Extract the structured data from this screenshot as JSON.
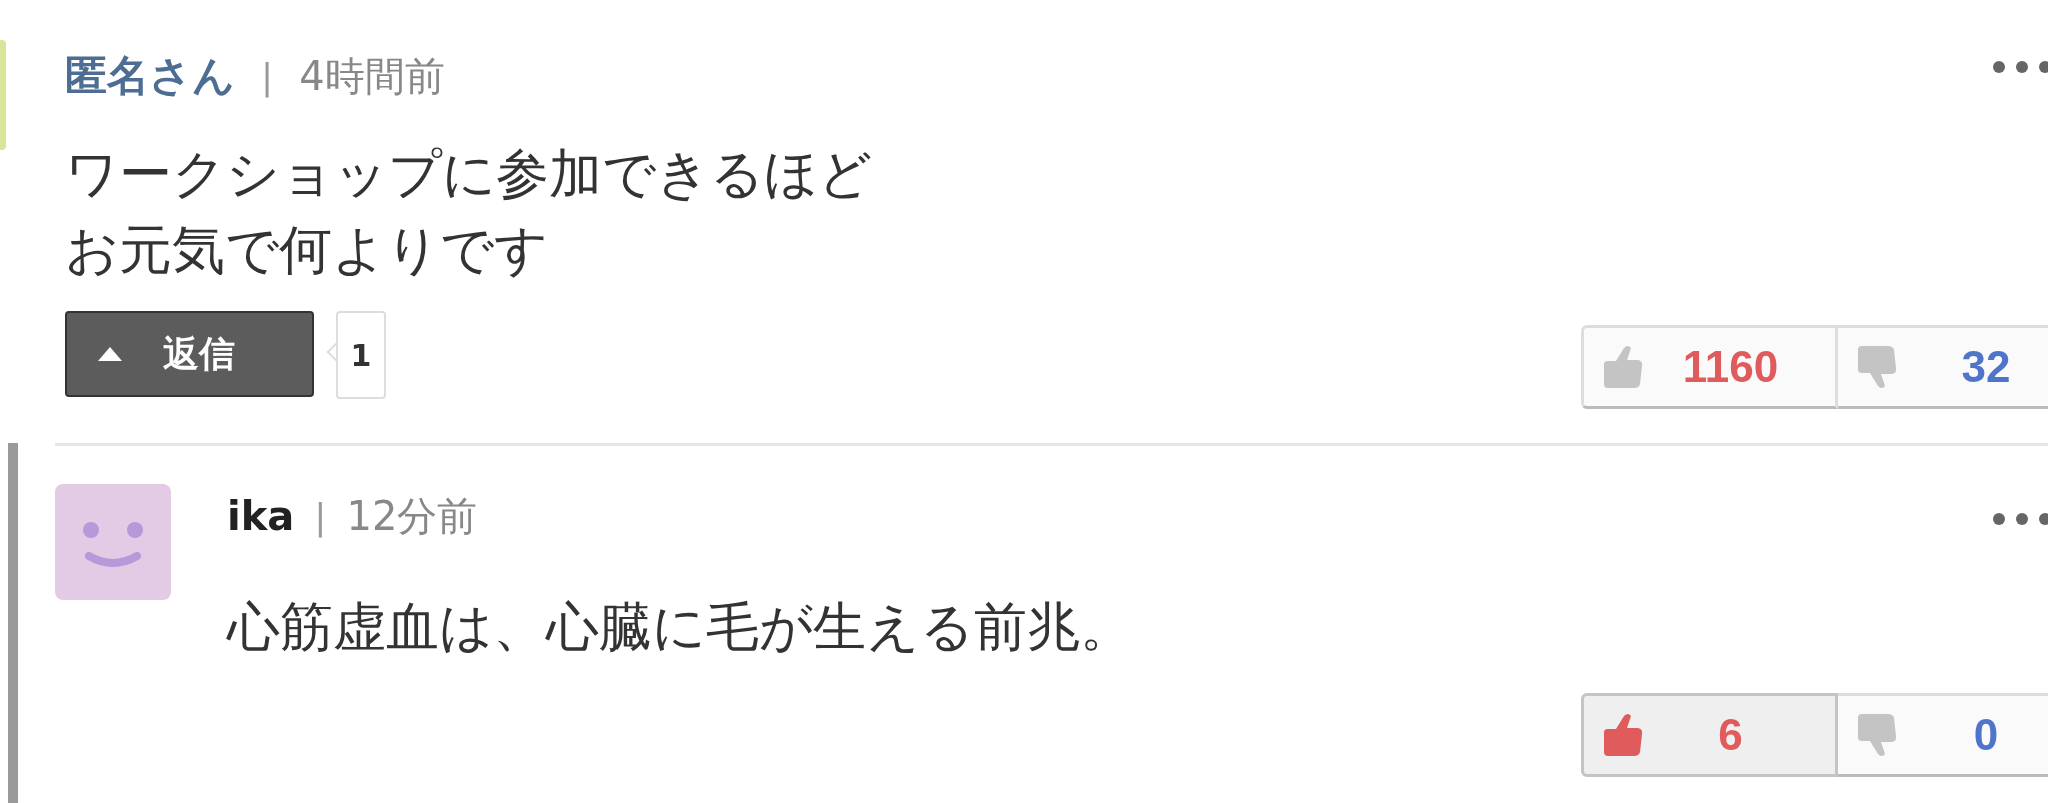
{
  "comment": {
    "author": "匿名さん",
    "separator": "|",
    "time": "4時間前",
    "body_lines": [
      "ワークショップに参加できるほど",
      "お元気で何よりです"
    ],
    "reply_label": "返信",
    "reply_count": "1",
    "votes": {
      "up": {
        "count": "1160",
        "selected": false
      },
      "down": {
        "count": "32",
        "selected": false
      }
    }
  },
  "reply": {
    "author": "ika",
    "separator": "|",
    "time": "12分前",
    "body": "心筋虚血は、心臓に毛が生える前兆。",
    "votes": {
      "up": {
        "count": "6",
        "selected": true
      },
      "down": {
        "count": "0",
        "selected": false
      }
    }
  }
}
